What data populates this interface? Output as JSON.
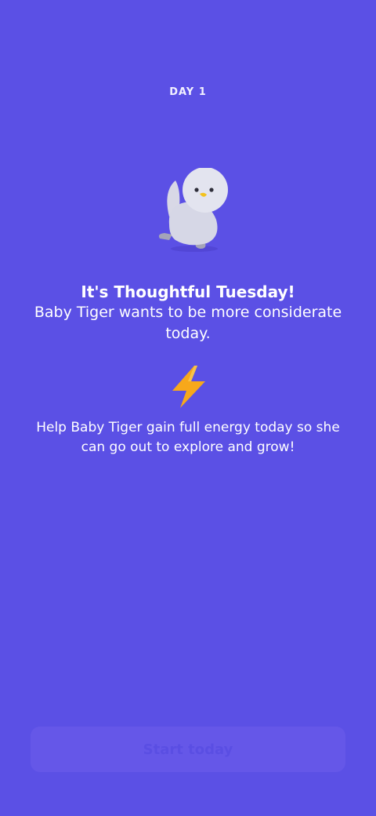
{
  "day_label": "DAY 1",
  "mascot": {
    "icon": "baby-bird-mascot-icon"
  },
  "headline": "It's Thoughtful Tuesday!",
  "subline": "Baby Tiger wants to be more considerate today.",
  "energy_icon": "lightning-bolt-icon",
  "help_text": "Help Baby Tiger gain full energy today so she can go out to explore and grow!",
  "start_button": {
    "label": "Start today",
    "state": "disabled"
  },
  "colors": {
    "background": "#5b50e5",
    "button_bg": "#6557e8",
    "bolt": "#f7a81b"
  }
}
